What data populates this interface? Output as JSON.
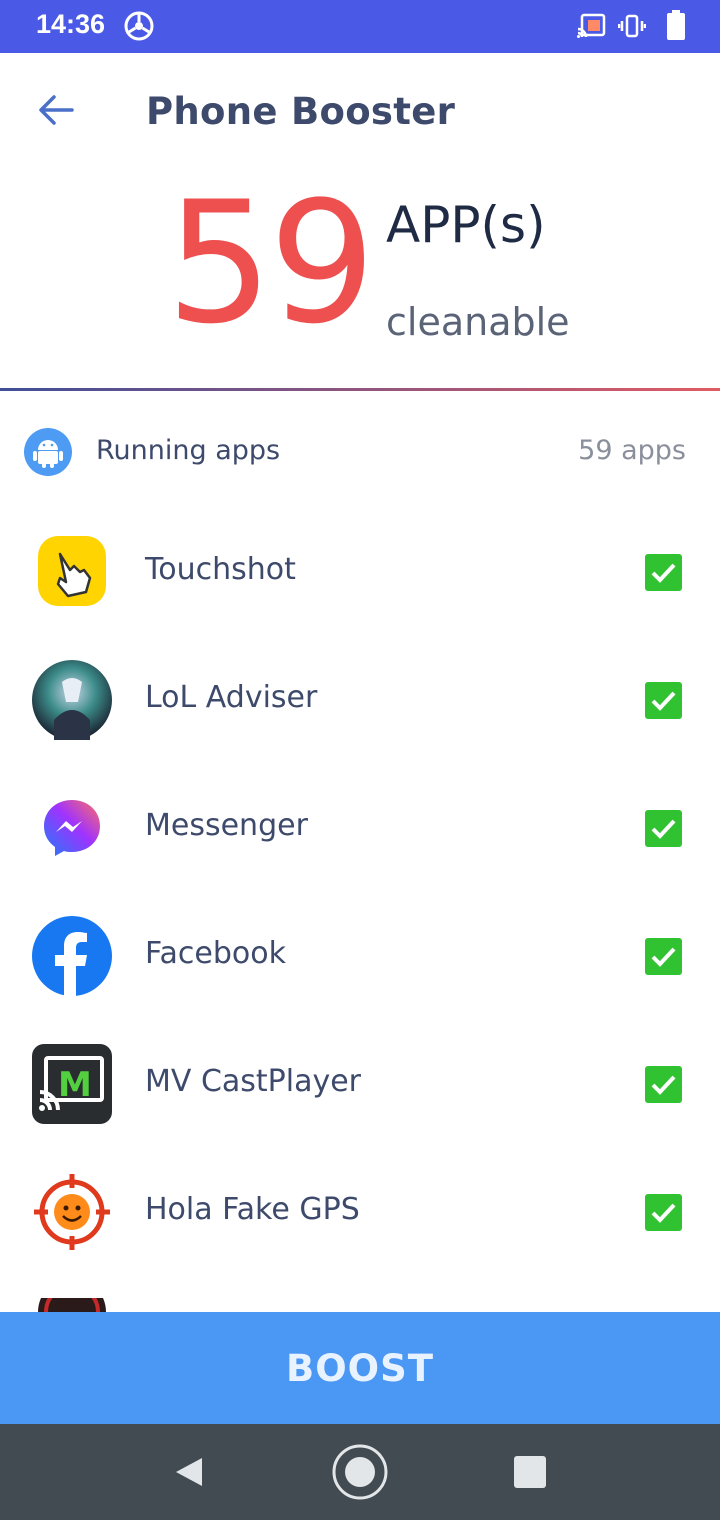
{
  "status_bar": {
    "time": "14:36",
    "icons": [
      "app-notification-icon",
      "cast-icon",
      "vibrate-icon",
      "battery-icon"
    ]
  },
  "header": {
    "title": "Phone Booster",
    "back_icon": "arrow-left-icon"
  },
  "summary": {
    "count": "59",
    "unit": "APP(s)",
    "caption": "cleanable"
  },
  "section": {
    "label": "Running apps",
    "count": "59 apps",
    "icon": "android-icon"
  },
  "apps": [
    {
      "name": "Touchshot",
      "checked": true
    },
    {
      "name": "LoL Adviser",
      "checked": true
    },
    {
      "name": "Messenger",
      "checked": true
    },
    {
      "name": "Facebook",
      "checked": true
    },
    {
      "name": "MV CastPlayer",
      "checked": true
    },
    {
      "name": "Hola Fake GPS",
      "checked": true
    }
  ],
  "boost_label": "BOOST",
  "colors": {
    "status_bar": "#4b5ae6",
    "count": "#ee5050",
    "check": "#31c231",
    "boost": "#4b97f4",
    "nav_bar": "#434b52"
  }
}
